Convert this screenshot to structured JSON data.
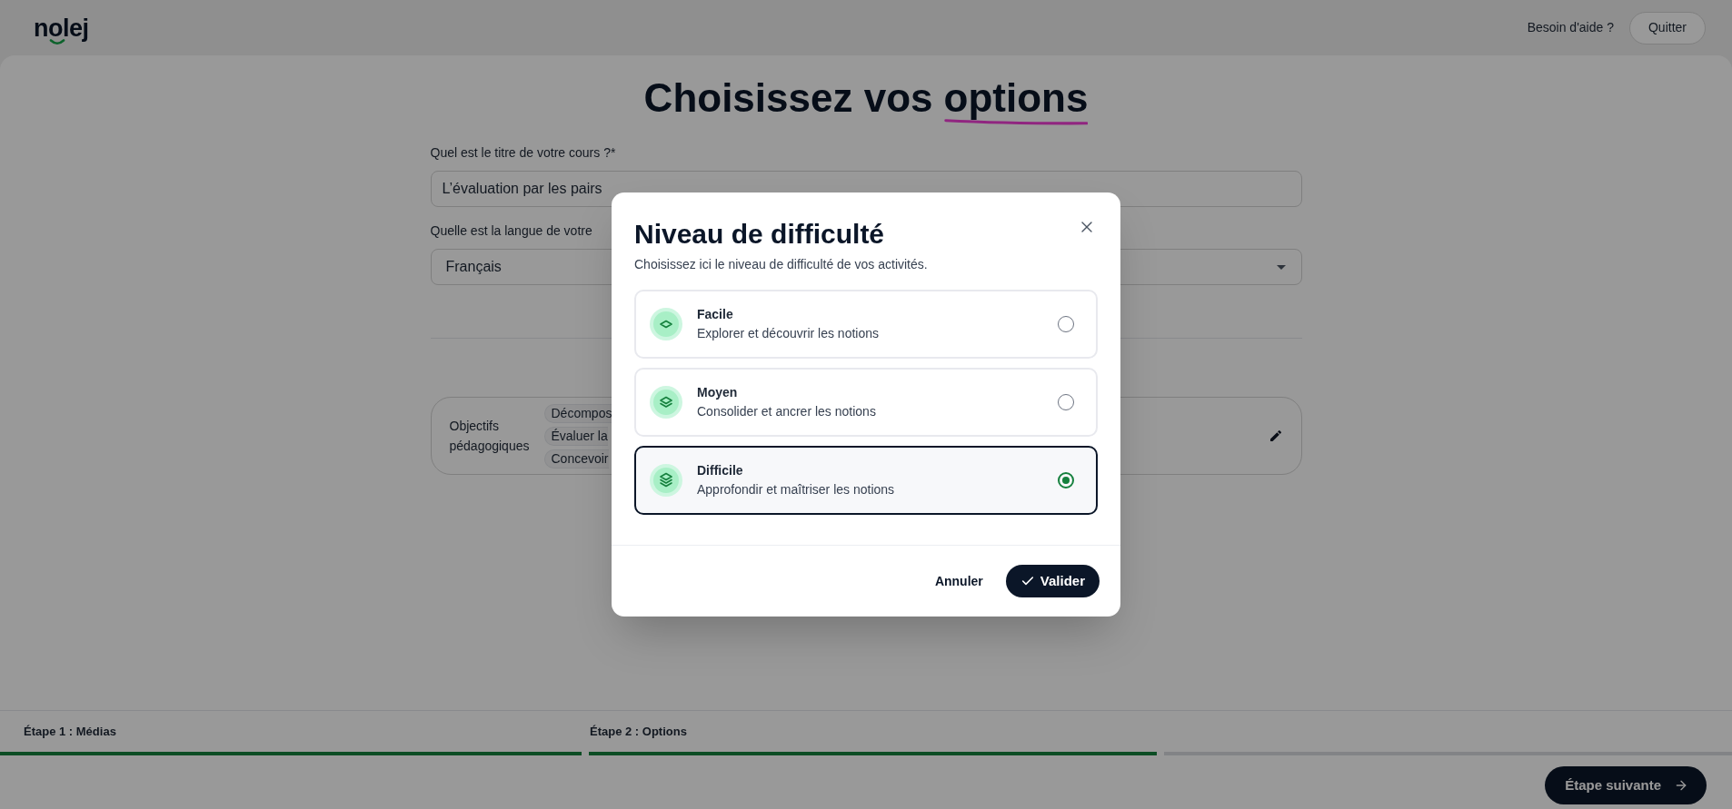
{
  "header": {
    "logo": "nolej",
    "help_link": "Besoin d'aide ?",
    "quit_button": "Quitter"
  },
  "page": {
    "title": "Choisissez vos",
    "title_highlight": "options",
    "fields": [
      {
        "kind": "text",
        "label": "Quel est le titre de votre cours ?*",
        "value": "L’évaluation par les pairs"
      },
      {
        "kind": "select",
        "label": "Quelle est la langue de votre",
        "value": "Français"
      }
    ],
    "objectives": {
      "label": "Objectifs pédagogiques",
      "chips": [
        "Décompos",
        "Évaluer la",
        "Concevoir"
      ]
    }
  },
  "modal": {
    "title": "Niveau de difficulté",
    "subtitle": "Choisissez ici le niveau de difficulté de vos activités.",
    "options": [
      {
        "kind": "easy",
        "title": "Facile",
        "description": "Explorer et découvrir les notions",
        "selected": false
      },
      {
        "kind": "medium",
        "title": "Moyen",
        "description": "Consolider et ancrer les notions",
        "selected": false
      },
      {
        "kind": "hard",
        "title": "Difficile",
        "description": "Approfondir et maîtriser les notions",
        "selected": true
      }
    ],
    "cancel_button": "Annuler",
    "confirm_button": "Valider"
  },
  "stepper": {
    "steps": [
      {
        "label": "Étape 1 : Médias",
        "completed": true
      },
      {
        "label": "Étape 2 : Options",
        "completed": true
      },
      {
        "completed": false
      }
    ],
    "next_button": "Étape suivante"
  }
}
